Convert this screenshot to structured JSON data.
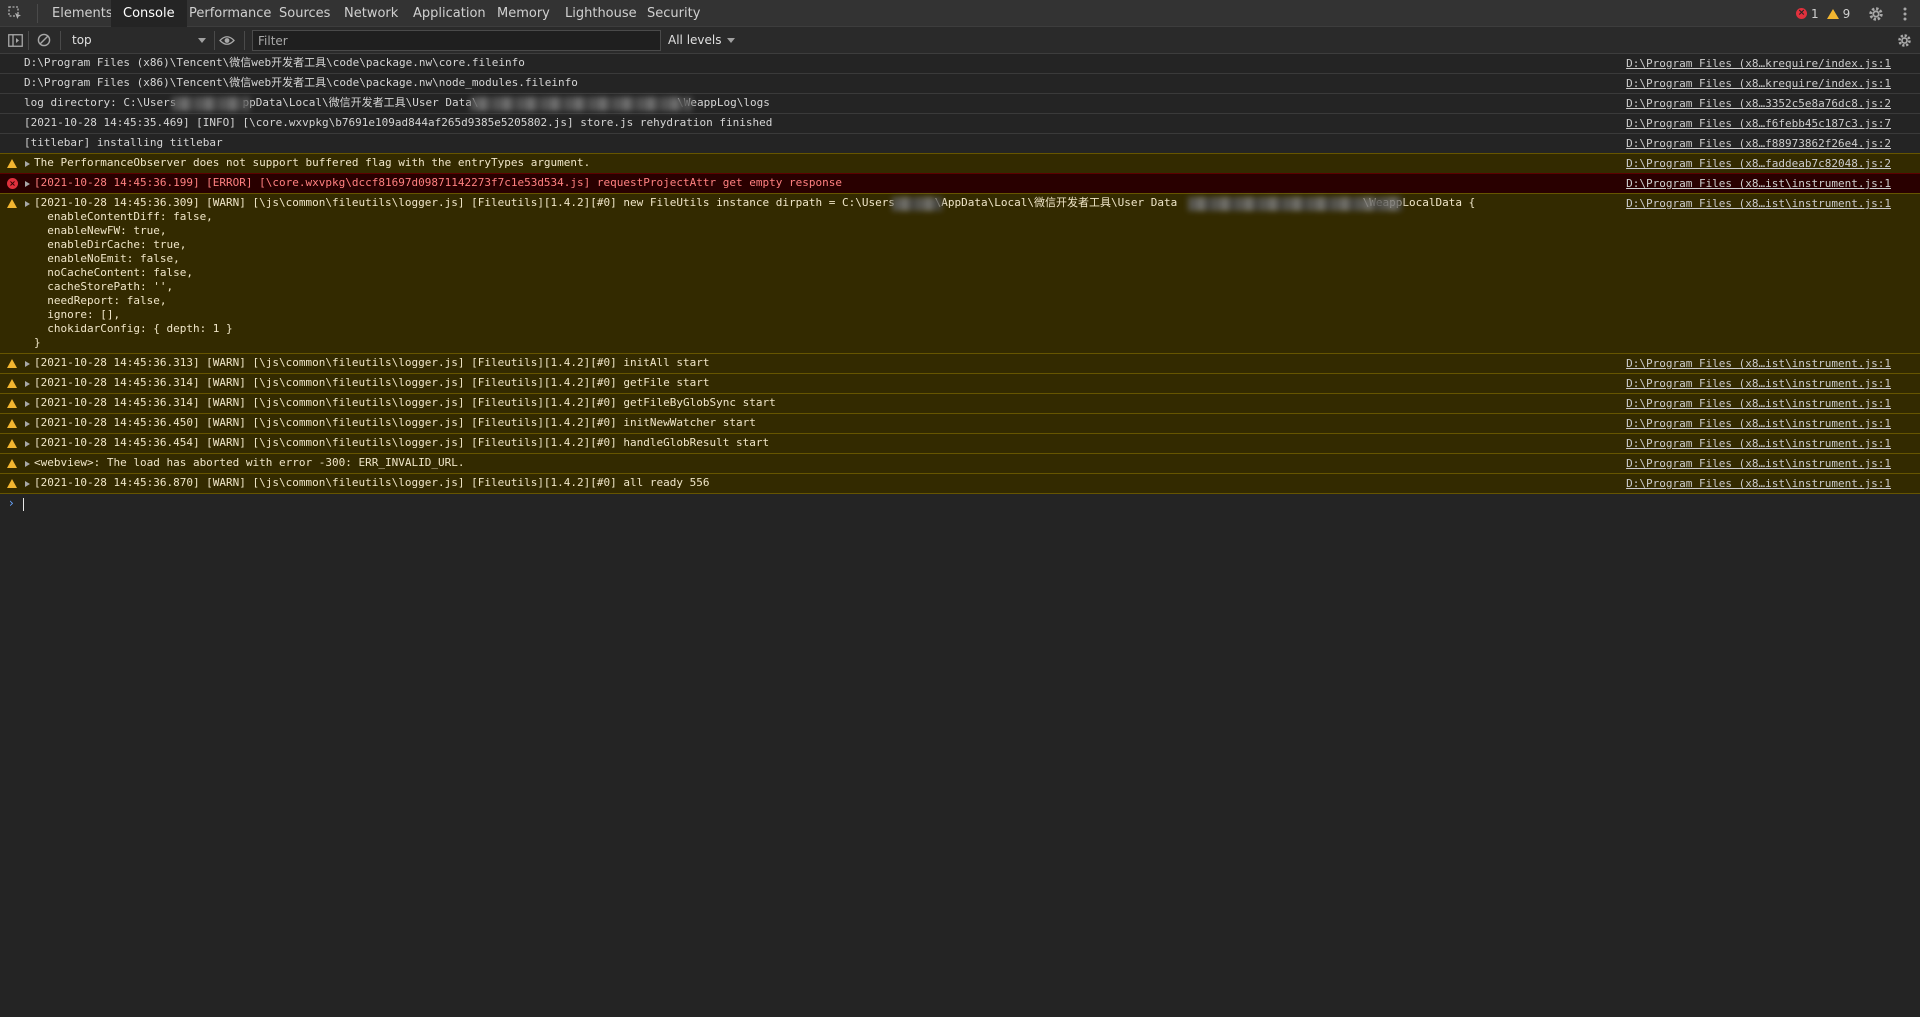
{
  "tabs": [
    "Elements",
    "Console",
    "Performance",
    "Sources",
    "Network",
    "Application",
    "Memory",
    "Lighthouse",
    "Security"
  ],
  "active_tab": "Console",
  "counters": {
    "errors": "1",
    "warnings": "9"
  },
  "toolbar": {
    "context": "top",
    "filter_placeholder": "Filter",
    "levels": "All levels"
  },
  "log": [
    {
      "level": "info",
      "text": "D:\\Program Files (x86)\\Tencent\\微信web开发者工具\\code\\package.nw\\core.fileinfo",
      "source": "D:\\Program Files (x8…krequire/index.js:1"
    },
    {
      "level": "info",
      "text": "D:\\Program Files (x86)\\Tencent\\微信web开发者工具\\code\\package.nw\\node_modules.fileinfo",
      "source": "D:\\Program Files (x8…krequire/index.js:1"
    },
    {
      "level": "info",
      "text": "log directory: C:\\Users          ppData\\Local\\微信开发者工具\\User Data\\                              \\WeappLog\\logs",
      "source": "D:\\Program Files (x8…3352c5e8a76dc8.js:2"
    },
    {
      "level": "info",
      "text": "[2021-10-28 14:45:35.469] [INFO] [\\core.wxvpkg\\b7691e109ad844af265d9385e5205802.js] store.js rehydration finished",
      "source": "D:\\Program Files (x8…f6febb45c187c3.js:7"
    },
    {
      "level": "info",
      "text": "[titlebar] installing titlebar",
      "source": "D:\\Program Files (x8…f88973862f26e4.js:2"
    },
    {
      "level": "warn",
      "text": "The PerformanceObserver does not support buffered flag with the entryTypes argument.",
      "source": "D:\\Program Files (x8…faddeab7c82048.js:2"
    },
    {
      "level": "error",
      "text": "[2021-10-28 14:45:36.199] [ERROR] [\\core.wxvpkg\\dccf81697d09871142273f7c1e53d534.js] requestProjectAttr get empty response",
      "source": "D:\\Program Files (x8…ist\\instrument.js:1"
    },
    {
      "level": "warn",
      "text": "[2021-10-28 14:45:36.309] [WARN] [\\js\\common\\fileutils\\logger.js] [Fileutils][1.4.2][#0] new FileUtils instance dirpath = C:\\Users      \\AppData\\Local\\微信开发者工具\\User Data                            \\WeappLocalData {\n  enableContentDiff: false,\n  enableNewFW: true,\n  enableDirCache: true,\n  enableNoEmit: false,\n  noCacheContent: false,\n  cacheStorePath: '',\n  needReport: false,\n  ignore: [],\n  chokidarConfig: { depth: 1 }\n}",
      "source": "D:\\Program Files (x8…ist\\instrument.js:1"
    },
    {
      "level": "warn",
      "text": "[2021-10-28 14:45:36.313] [WARN] [\\js\\common\\fileutils\\logger.js] [Fileutils][1.4.2][#0] initAll start",
      "source": "D:\\Program Files (x8…ist\\instrument.js:1"
    },
    {
      "level": "warn",
      "text": "[2021-10-28 14:45:36.314] [WARN] [\\js\\common\\fileutils\\logger.js] [Fileutils][1.4.2][#0] getFile start",
      "source": "D:\\Program Files (x8…ist\\instrument.js:1"
    },
    {
      "level": "warn",
      "text": "[2021-10-28 14:45:36.314] [WARN] [\\js\\common\\fileutils\\logger.js] [Fileutils][1.4.2][#0] getFileByGlobSync start",
      "source": "D:\\Program Files (x8…ist\\instrument.js:1"
    },
    {
      "level": "warn",
      "text": "[2021-10-28 14:45:36.450] [WARN] [\\js\\common\\fileutils\\logger.js] [Fileutils][1.4.2][#0] initNewWatcher start",
      "source": "D:\\Program Files (x8…ist\\instrument.js:1"
    },
    {
      "level": "warn",
      "text": "[2021-10-28 14:45:36.454] [WARN] [\\js\\common\\fileutils\\logger.js] [Fileutils][1.4.2][#0] handleGlobResult start",
      "source": "D:\\Program Files (x8…ist\\instrument.js:1"
    },
    {
      "level": "warn",
      "text": "<webview>: The load has aborted with error -300: ERR_INVALID_URL.",
      "source": "D:\\Program Files (x8…ist\\instrument.js:1"
    },
    {
      "level": "warn",
      "text": "[2021-10-28 14:45:36.870] [WARN] [\\js\\common\\fileutils\\logger.js] [Fileutils][1.4.2][#0] all ready 556",
      "source": "D:\\Program Files (x8…ist\\instrument.js:1"
    }
  ]
}
